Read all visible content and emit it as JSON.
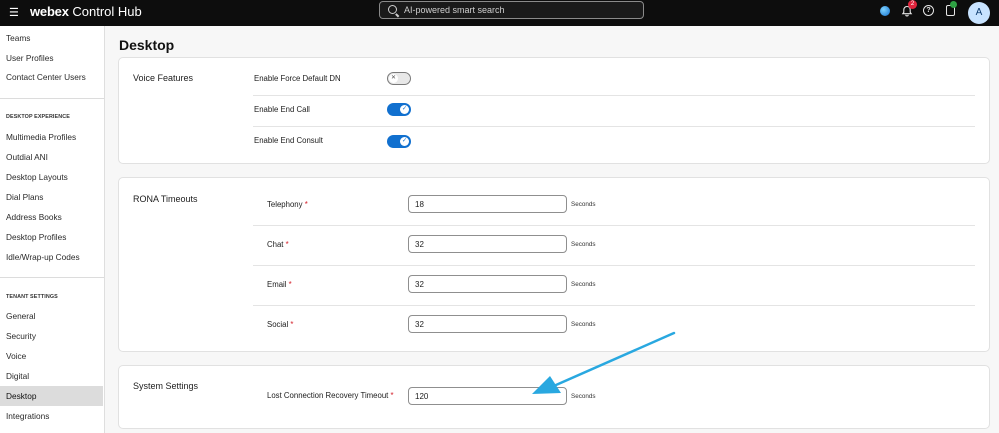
{
  "header": {
    "menu_icon": "hamburger-icon",
    "brand_bold": "webex",
    "brand_rest": " Control Hub",
    "search_placeholder": "AI-powered smart search",
    "notification_count": "2",
    "avatar_initial": "A"
  },
  "sidebar": {
    "top_items": [
      "Teams",
      "User Profiles",
      "Contact Center Users"
    ],
    "desktop_experience_heading": "DESKTOP EXPERIENCE",
    "desktop_items": [
      "Multimedia Profiles",
      "Outdial ANI",
      "Desktop Layouts",
      "Dial Plans",
      "Address Books",
      "Desktop Profiles",
      "Idle/Wrap-up Codes"
    ],
    "tenant_heading": "TENANT SETTINGS",
    "tenant_items": [
      "General",
      "Security",
      "Voice",
      "Digital",
      "Desktop",
      "Integrations"
    ],
    "active_item": "Desktop"
  },
  "page": {
    "title": "Desktop"
  },
  "voice_features": {
    "title": "Voice Features",
    "items": [
      {
        "label": "Enable Force Default DN",
        "enabled": false
      },
      {
        "label": "Enable End Call",
        "enabled": true
      },
      {
        "label": "Enable End Consult",
        "enabled": true
      }
    ]
  },
  "rona_timeouts": {
    "title": "RONA Timeouts",
    "rows": [
      {
        "label": "Telephony",
        "required": "*",
        "value": "18",
        "unit": "Seconds"
      },
      {
        "label": "Chat",
        "required": "*",
        "value": "32",
        "unit": "Seconds"
      },
      {
        "label": "Email",
        "required": "*",
        "value": "32",
        "unit": "Seconds"
      },
      {
        "label": "Social",
        "required": "*",
        "value": "32",
        "unit": "Seconds"
      }
    ]
  },
  "system_settings": {
    "title": "System Settings",
    "rows": [
      {
        "label": "Lost Connection Recovery Timeout",
        "required": "*",
        "value": "120",
        "unit": "Seconds"
      }
    ]
  },
  "colors": {
    "accent": "#1170cf",
    "annotation_arrow": "#29a8e0",
    "required": "#d4212b"
  }
}
